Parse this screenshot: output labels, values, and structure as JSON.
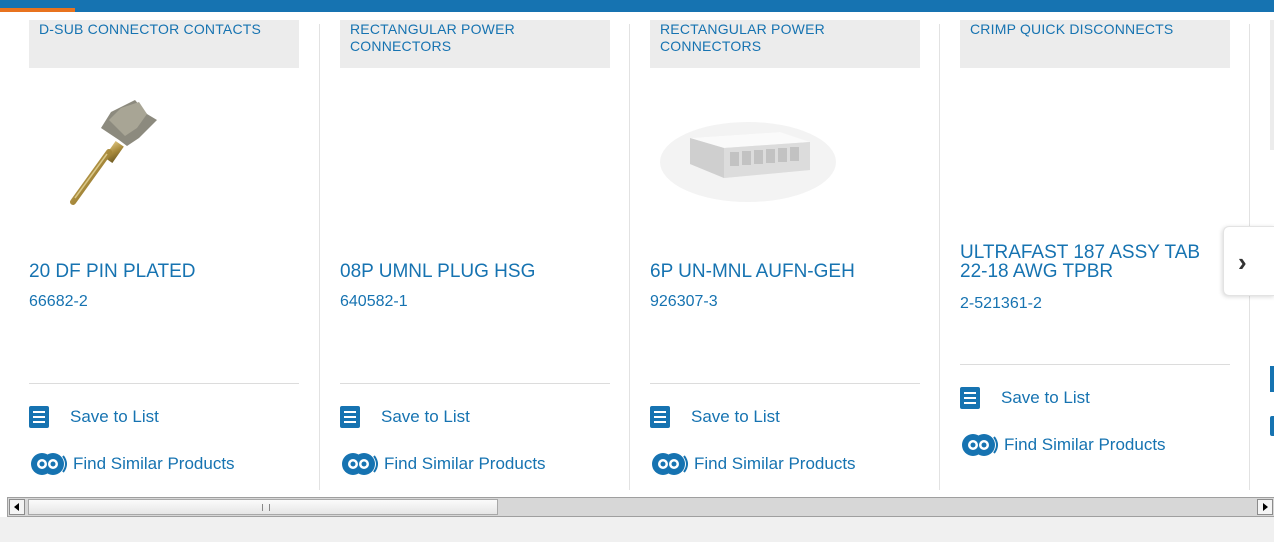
{
  "cards": [
    {
      "category": "D-SUB CONNECTOR CONTACTS",
      "title": "20 DF PIN PLATED",
      "part_number": "66682-2",
      "image": "gold-pin-contact",
      "save_label": "Save to List",
      "similar_label": "Find Similar Products"
    },
    {
      "category": "RECTANGULAR POWER CONNECTORS",
      "title": "08P UMNL PLUG HSG",
      "part_number": "640582-1",
      "image": "",
      "save_label": "Save to List",
      "similar_label": "Find Similar Products"
    },
    {
      "category": "RECTANGULAR POWER CONNECTORS",
      "title": "6P UN-MNL AUFN-GEH",
      "part_number": "926307-3",
      "image": "white-connector-housing",
      "save_label": "Save to List",
      "similar_label": "Find Similar Products"
    },
    {
      "category": "CRIMP QUICK DISCONNECTS",
      "title": "ULTRAFAST 187 ASSY TAB 22-18 AWG TPBR",
      "part_number": "2-521361-2",
      "image": "",
      "save_label": "Save to List",
      "similar_label": "Find Similar Products"
    }
  ],
  "colors": {
    "brand_blue": "#1673b1",
    "accent_orange": "#e8731f"
  },
  "icons": {
    "save": "checklist-icon",
    "similar": "similar-products-icon",
    "next": "chevron-right-icon"
  }
}
